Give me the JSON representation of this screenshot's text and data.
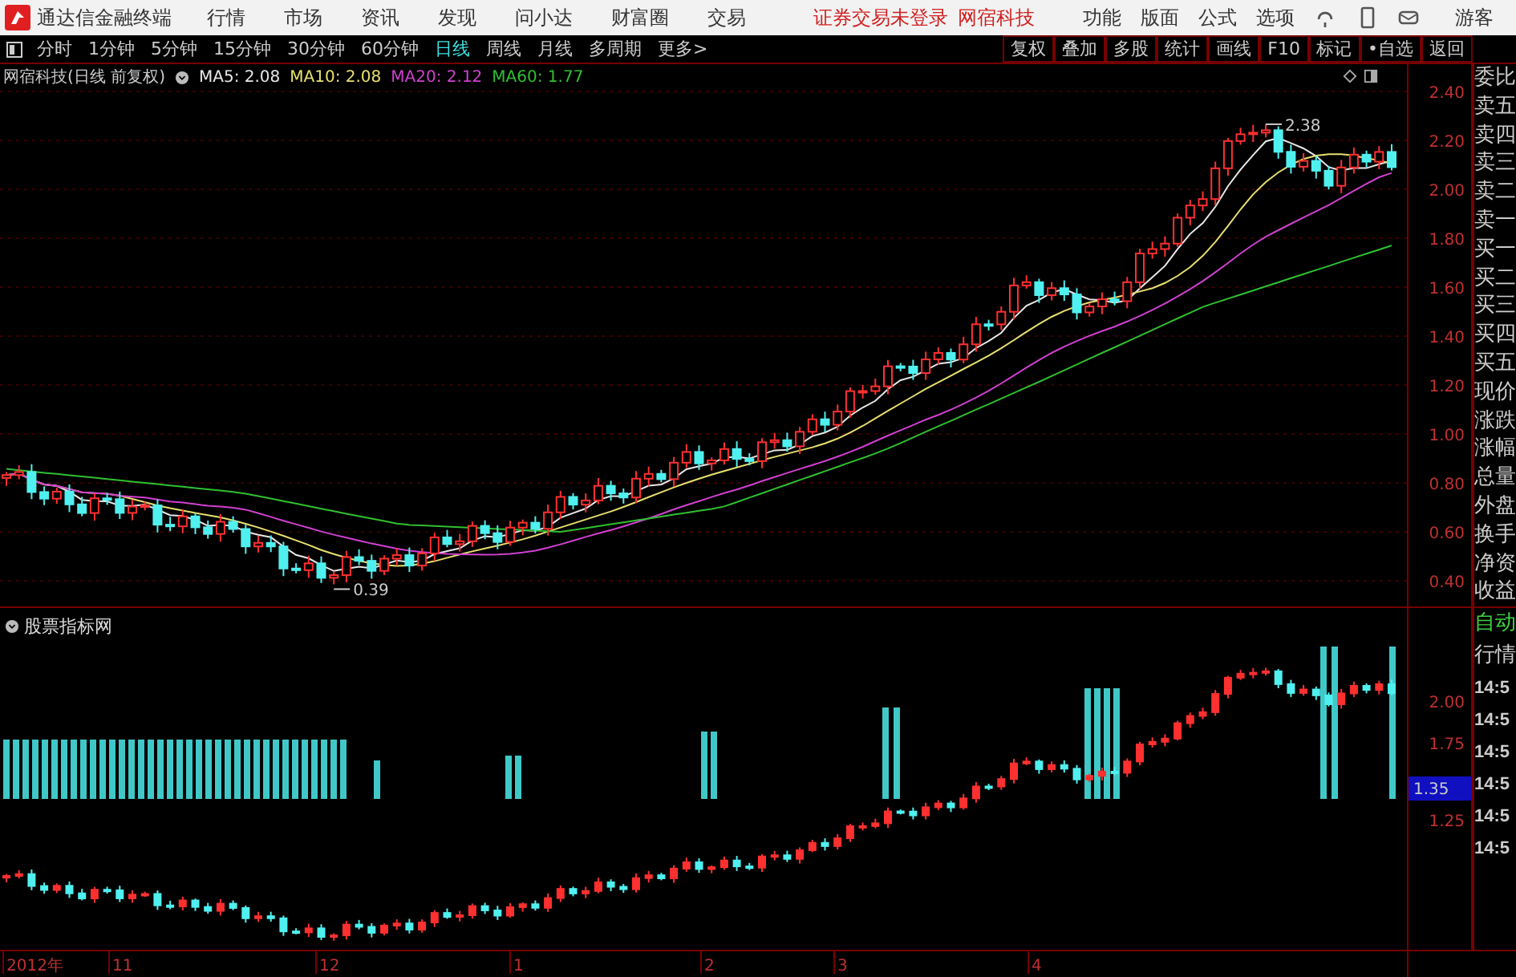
{
  "title_bar": {
    "app_name": "通达信金融终端",
    "menus": [
      "行情",
      "市场",
      "资讯",
      "发现",
      "问小达",
      "财富圈",
      "交易"
    ],
    "notice": "证券交易未登录",
    "stock": "网宿科技",
    "tools": [
      "功能",
      "版面",
      "公式",
      "选项"
    ],
    "user": "游客"
  },
  "period_tabs": [
    {
      "label": "分时",
      "selected": false
    },
    {
      "label": "1分钟",
      "selected": false
    },
    {
      "label": "5分钟",
      "selected": false
    },
    {
      "label": "15分钟",
      "selected": false
    },
    {
      "label": "30分钟",
      "selected": false
    },
    {
      "label": "60分钟",
      "selected": false
    },
    {
      "label": "日线",
      "selected": true
    },
    {
      "label": "周线",
      "selected": false
    },
    {
      "label": "月线",
      "selected": false
    },
    {
      "label": "多周期",
      "selected": false
    },
    {
      "label": "更多>",
      "selected": false
    }
  ],
  "tool_buttons": [
    "复权",
    "叠加",
    "多股",
    "统计",
    "画线",
    "F10",
    "标记",
    "•自选",
    "返回"
  ],
  "main_chart": {
    "legend_title": "网宿科技(日线 前复权)",
    "ma": [
      {
        "label": "MA5: 2.08",
        "color": "#e8e8e8"
      },
      {
        "label": "MA10: 2.08",
        "color": "#e8e070"
      },
      {
        "label": "MA20: 2.12",
        "color": "#d040d0"
      },
      {
        "label": "MA60: 1.77",
        "color": "#30c030"
      }
    ],
    "high_label": "2.38",
    "low_label": "0.39",
    "y_ticks": [
      "2.40",
      "2.20",
      "2.00",
      "1.80",
      "1.60",
      "1.40",
      "1.20",
      "1.00",
      "0.80",
      "0.60",
      "0.40"
    ]
  },
  "quote_labels": [
    "委比",
    "卖五",
    "卖四",
    "卖三",
    "卖二",
    "卖一",
    "买一",
    "买二",
    "买三",
    "买四",
    "买五",
    "现价",
    "涨跌",
    "涨幅",
    "总量",
    "外盘",
    "换手",
    "净资",
    "收益"
  ],
  "indicator_panel": {
    "title": "股票指标网",
    "y_ticks": [
      "2.00",
      "1.75",
      "1.25"
    ],
    "current_value": "1.35"
  },
  "trade_panel": {
    "mode": "自动",
    "title": "行情",
    "times": [
      "14:5",
      "14:5",
      "14:5",
      "14:5",
      "14:5",
      "14:5"
    ]
  },
  "time_axis": [
    "2012年",
    "11",
    "12",
    "1",
    "2",
    "3",
    "4"
  ]
}
